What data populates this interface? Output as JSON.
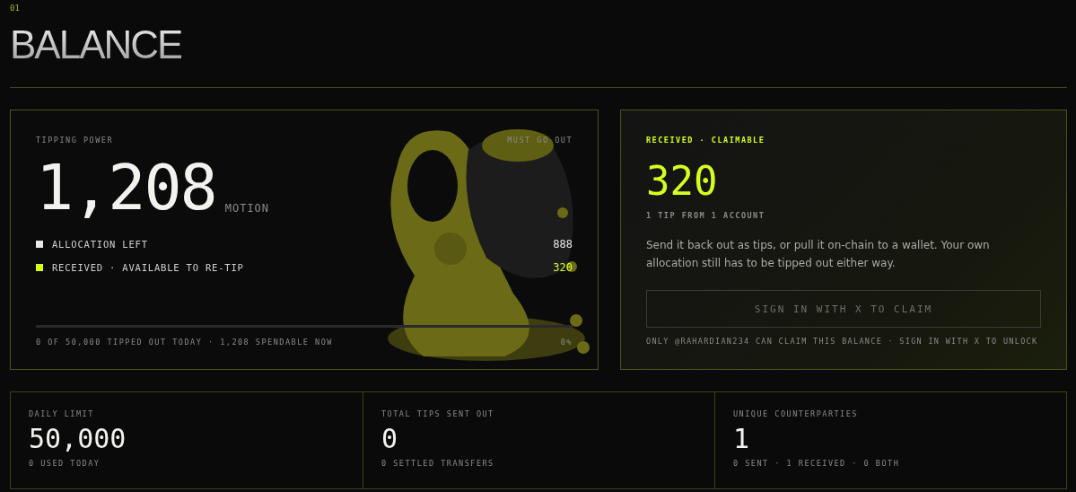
{
  "section": {
    "number": "01",
    "title": "BALANCE"
  },
  "tipping_power": {
    "label": "TIPPING POWER",
    "tag": "MUST GO OUT",
    "amount": "1,208",
    "unit": "MOTION",
    "legend": [
      {
        "label": "ALLOCATION LEFT",
        "value": "888",
        "color": "#e8e8e8"
      },
      {
        "label": "RECEIVED · AVAILABLE TO RE-TIP",
        "value": "320",
        "color": "#d4ff1e"
      }
    ],
    "progress": {
      "level": 0,
      "caption": "0 OF 50,000 TIPPED OUT TODAY · 1,208 SPENDABLE NOW",
      "percent": "0%"
    }
  },
  "claimable": {
    "label": "RECEIVED · CLAIMABLE",
    "amount": "320",
    "sub": "1 TIP FROM 1 ACCOUNT",
    "description": "Send it back out as tips, or pull it on-chain to a wallet. Your own allocation still has to be tipped out either way.",
    "button": {
      "label": "SIGN IN WITH X TO CLAIM",
      "disabled": true
    },
    "note": "ONLY @RAHARDIAN234 CAN CLAIM THIS BALANCE · SIGN IN WITH X TO UNLOCK"
  },
  "stats": [
    {
      "label": "DAILY LIMIT",
      "value": "50,000",
      "sub": "0 USED TODAY"
    },
    {
      "label": "TOTAL TIPS SENT OUT",
      "value": "0",
      "sub": "0 SETTLED TRANSFERS"
    },
    {
      "label": "UNIQUE COUNTERPARTIES",
      "value": "1",
      "sub": "0 SENT · 1 RECEIVED · 0 BOTH"
    }
  ]
}
